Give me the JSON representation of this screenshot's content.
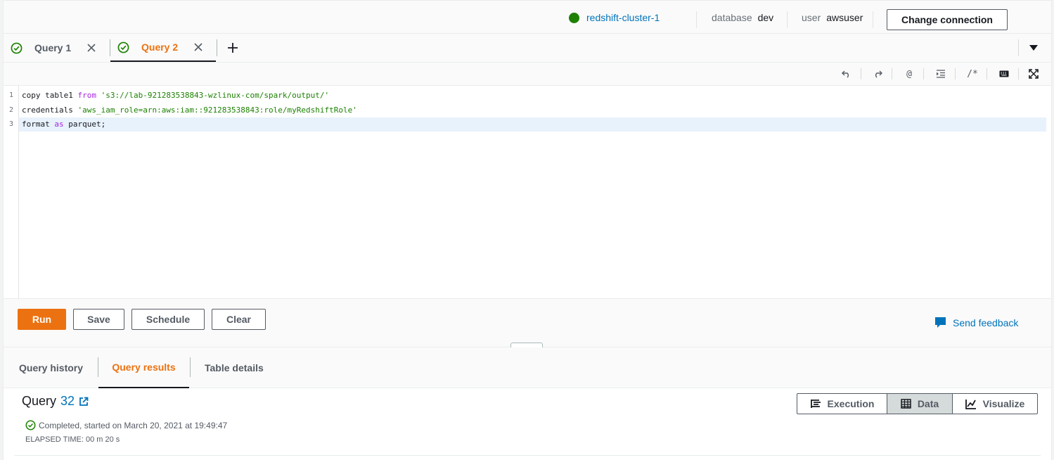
{
  "connection": {
    "cluster": "redshift-cluster-1",
    "status_color": "#1d8102",
    "database_label": "database",
    "database_value": "dev",
    "user_label": "user",
    "user_value": "awsuser",
    "change_button": "Change connection"
  },
  "tabs": [
    {
      "label": "Query 1",
      "active": false,
      "icon": "check-circle-icon"
    },
    {
      "label": "Query 2",
      "active": true,
      "icon": "check-circle-icon"
    }
  ],
  "toolbar": {
    "icons": [
      "undo-icon",
      "redo-icon",
      "at-icon",
      "indent-icon",
      "comment-icon",
      "keyboard-icon",
      "fullscreen-icon"
    ],
    "at_glyph": "@",
    "comment_glyph": "/*"
  },
  "editor": {
    "line_numbers": [
      "1",
      "2",
      "3"
    ],
    "lines": [
      {
        "t1": "copy table1 ",
        "kw": "from",
        "t2": " ",
        "str": "'s3://lab-921283538843-wzlinux-com/spark/output/'",
        "t3": ""
      },
      {
        "t1": "credentials ",
        "kw": "",
        "t2": "",
        "str": "'aws_iam_role=arn:aws:iam::921283538843:role/myRedshiftRole'",
        "t3": ""
      },
      {
        "t1": "format ",
        "kw": "as",
        "t2": " parquet;",
        "str": "",
        "t3": ""
      }
    ]
  },
  "actions": {
    "run": "Run",
    "save": "Save",
    "schedule": "Schedule",
    "clear": "Clear",
    "feedback": "Send feedback"
  },
  "bottom_tabs": [
    {
      "label": "Query history",
      "active": false
    },
    {
      "label": "Query results",
      "active": true
    },
    {
      "label": "Table details",
      "active": false
    }
  ],
  "results": {
    "query_label": "Query",
    "query_number": "32",
    "status": "Completed, started on March 20, 2021 at 19:49:47",
    "elapsed": "ELAPSED TIME: 00 m 20 s",
    "views": [
      {
        "label": "Execution",
        "icon": "execution-icon",
        "selected": false
      },
      {
        "label": "Data",
        "icon": "table-grid-icon",
        "selected": true
      },
      {
        "label": "Visualize",
        "icon": "chart-line-icon",
        "selected": false
      }
    ]
  },
  "colors": {
    "accent": "#ec7211",
    "link": "#0073bb",
    "success": "#1d8102"
  }
}
